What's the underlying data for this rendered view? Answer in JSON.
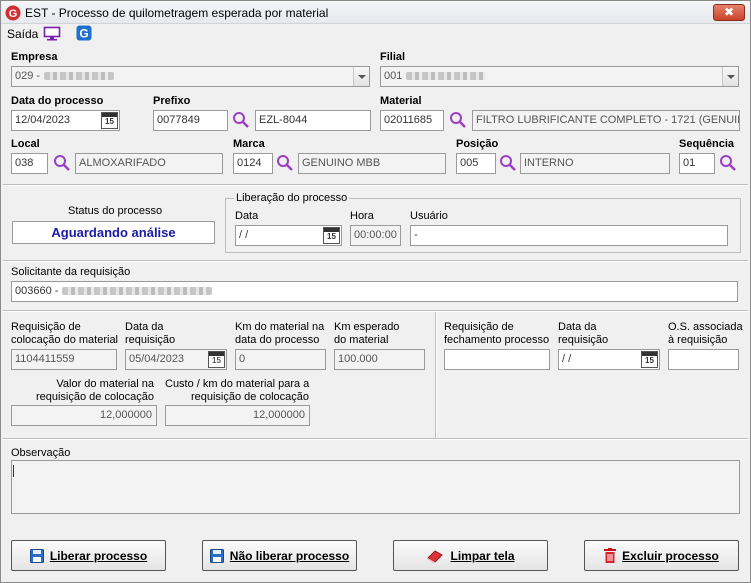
{
  "window": {
    "title": "EST - Processo de quilometragem esperada por material",
    "close_label": "✖"
  },
  "menu": {
    "saida": "Saída"
  },
  "empresa": {
    "label": "Empresa",
    "value": "029 -"
  },
  "filial": {
    "label": "Filial",
    "value": "001"
  },
  "data_processo": {
    "label": "Data do processo",
    "value": "12/04/2023"
  },
  "prefixo": {
    "label": "Prefixo",
    "code": "0077849",
    "plate": "EZL-8044"
  },
  "material": {
    "label": "Material",
    "code": "02011685",
    "description": "FILTRO LUBRIFICANTE COMPLETO - 1721 (GENUIN"
  },
  "local": {
    "label": "Local",
    "code": "038",
    "description": "ALMOXARIFADO"
  },
  "marca": {
    "label": "Marca",
    "code": "0124",
    "description": "GENUINO MBB"
  },
  "posicao": {
    "label": "Posição",
    "code": "005",
    "description": "INTERNO"
  },
  "sequencia": {
    "label": "Sequência",
    "value": "01"
  },
  "status": {
    "label": "Status do processo",
    "value": "Aguardando análise"
  },
  "liberacao": {
    "group_label": "Liberação do processo",
    "data_label": "Data",
    "data_value": " /  /",
    "hora_label": "Hora",
    "hora_value": "00:00:00",
    "usuario_label": "Usuário",
    "usuario_value": "-"
  },
  "solicitante": {
    "label": "Solicitante da requisição",
    "value": "003660 -"
  },
  "colocacao": {
    "req_label_1": "Requisição de",
    "req_label_2": "colocação do material",
    "req_value": "1104411559",
    "data_label_1": "Data da",
    "data_label_2": "requisição",
    "data_value": "05/04/2023",
    "km_mat_label_1": "Km do material na",
    "km_mat_label_2": "data do processo",
    "km_mat_value": "0",
    "km_esp_label_1": "Km esperado",
    "km_esp_label_2": "do material",
    "km_esp_value": "100.000",
    "valor_label_1": "Valor do material na",
    "valor_label_2": "requisição de colocação",
    "valor_value": "12,000000",
    "custo_label_1": "Custo / km do material para a",
    "custo_label_2": "requisição de colocação",
    "custo_value": "12,000000"
  },
  "fechamento": {
    "req_label_1": "Requisição de",
    "req_label_2": "fechamento processo",
    "req_value": "",
    "data_label_1": "Data da",
    "data_label_2": "requisição",
    "data_value": " /  /",
    "os_label_1": "O.S. associada",
    "os_label_2": "à requisição",
    "os_value": ""
  },
  "observacao": {
    "label": "Observação",
    "value": ""
  },
  "buttons": {
    "liberar": "Liberar processo",
    "nao_liberar": "Não liberar processo",
    "limpar": "Limpar tela",
    "excluir": "Excluir processo"
  },
  "calendar_badge": "15",
  "colors": {
    "status_text": "#1a1aa6",
    "magnifier": "#9b3fc6",
    "logo_red": "#d03030",
    "brand_blue": "#1f6fd0"
  }
}
